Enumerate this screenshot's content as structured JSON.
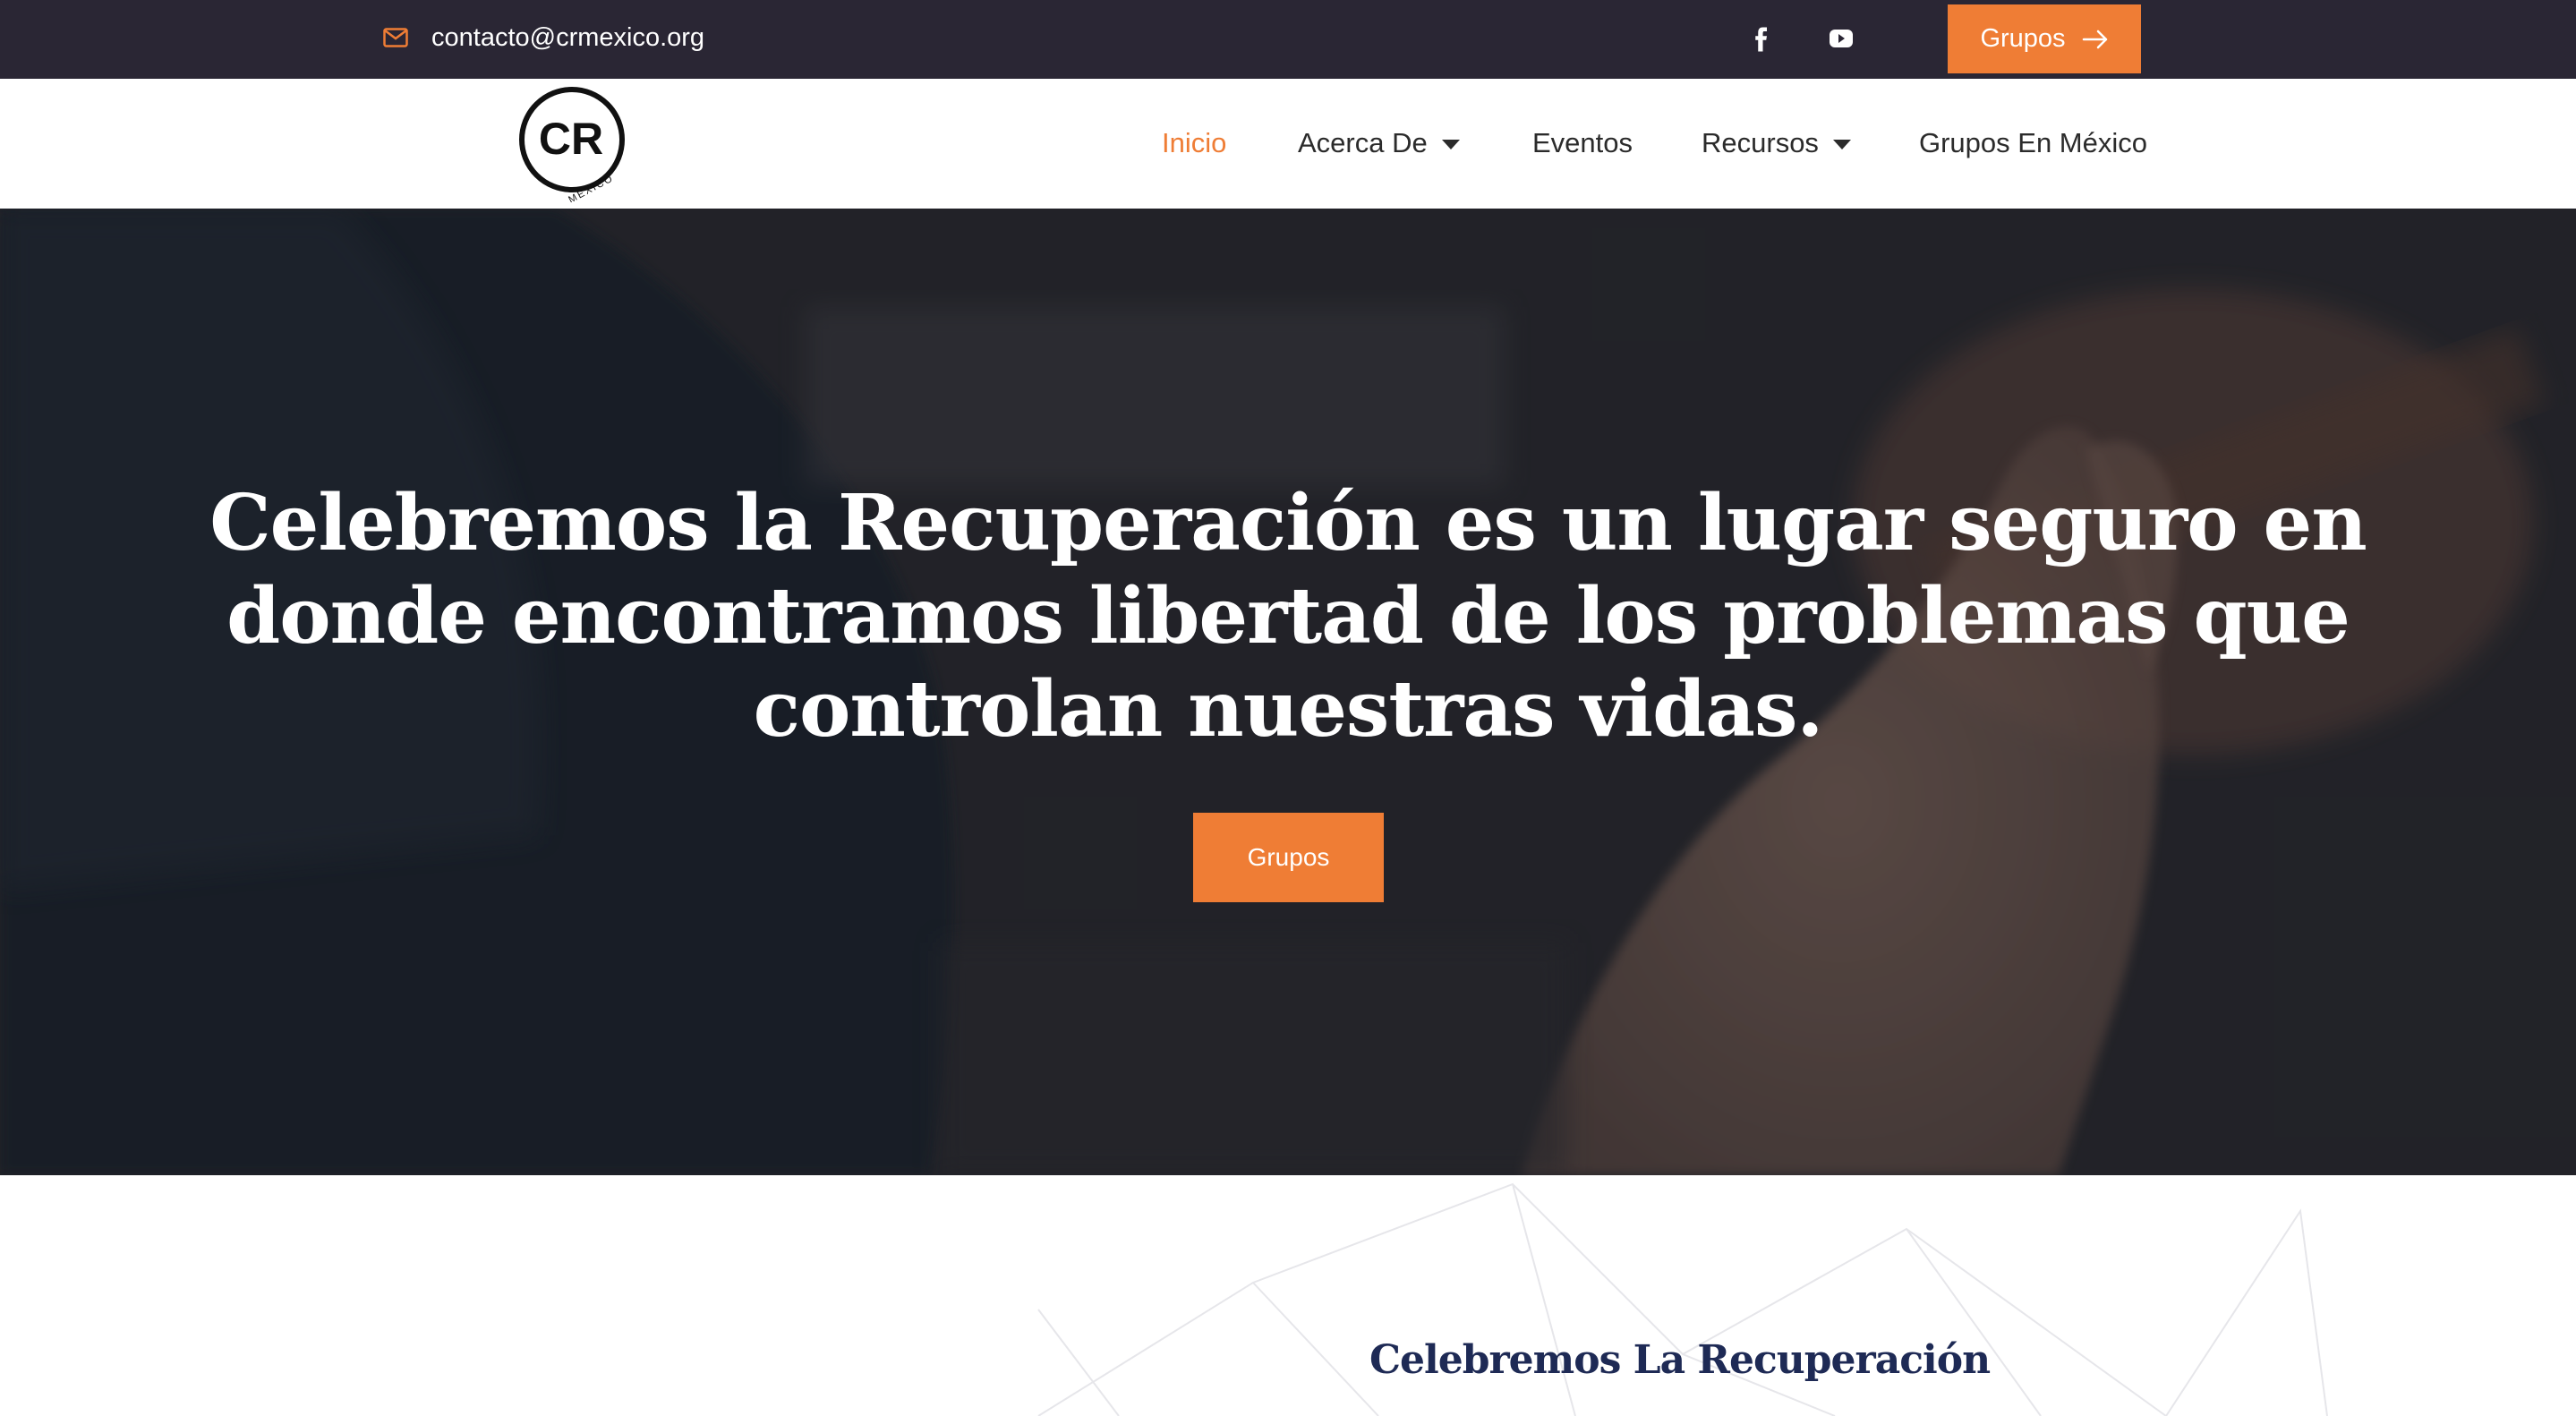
{
  "topbar": {
    "email": "contacto@crmexico.org",
    "email_icon": "envelope-icon",
    "social": [
      {
        "name": "facebook-icon"
      },
      {
        "name": "youtube-icon"
      }
    ],
    "button_label": "Grupos",
    "button_icon": "arrow-right-icon"
  },
  "logo": {
    "letters": "CR",
    "subtitle": "MÉXICO"
  },
  "nav": {
    "items": [
      {
        "label": "Inicio",
        "active": true,
        "dropdown": false
      },
      {
        "label": "Acerca De",
        "active": false,
        "dropdown": true
      },
      {
        "label": "Eventos",
        "active": false,
        "dropdown": false
      },
      {
        "label": "Recursos",
        "active": false,
        "dropdown": true
      },
      {
        "label": "Grupos En México",
        "active": false,
        "dropdown": false
      }
    ]
  },
  "hero": {
    "title": "Celebremos la Recuperación es un lugar seguro en donde encontramos libertad de los problemas que controlan nuestras vidas.",
    "button_label": "Grupos"
  },
  "about": {
    "title": "Celebremos La Recuperación"
  },
  "colors": {
    "accent": "#ef7d35",
    "topbar_bg": "#2a2634",
    "heading_navy": "#1e2a55"
  }
}
